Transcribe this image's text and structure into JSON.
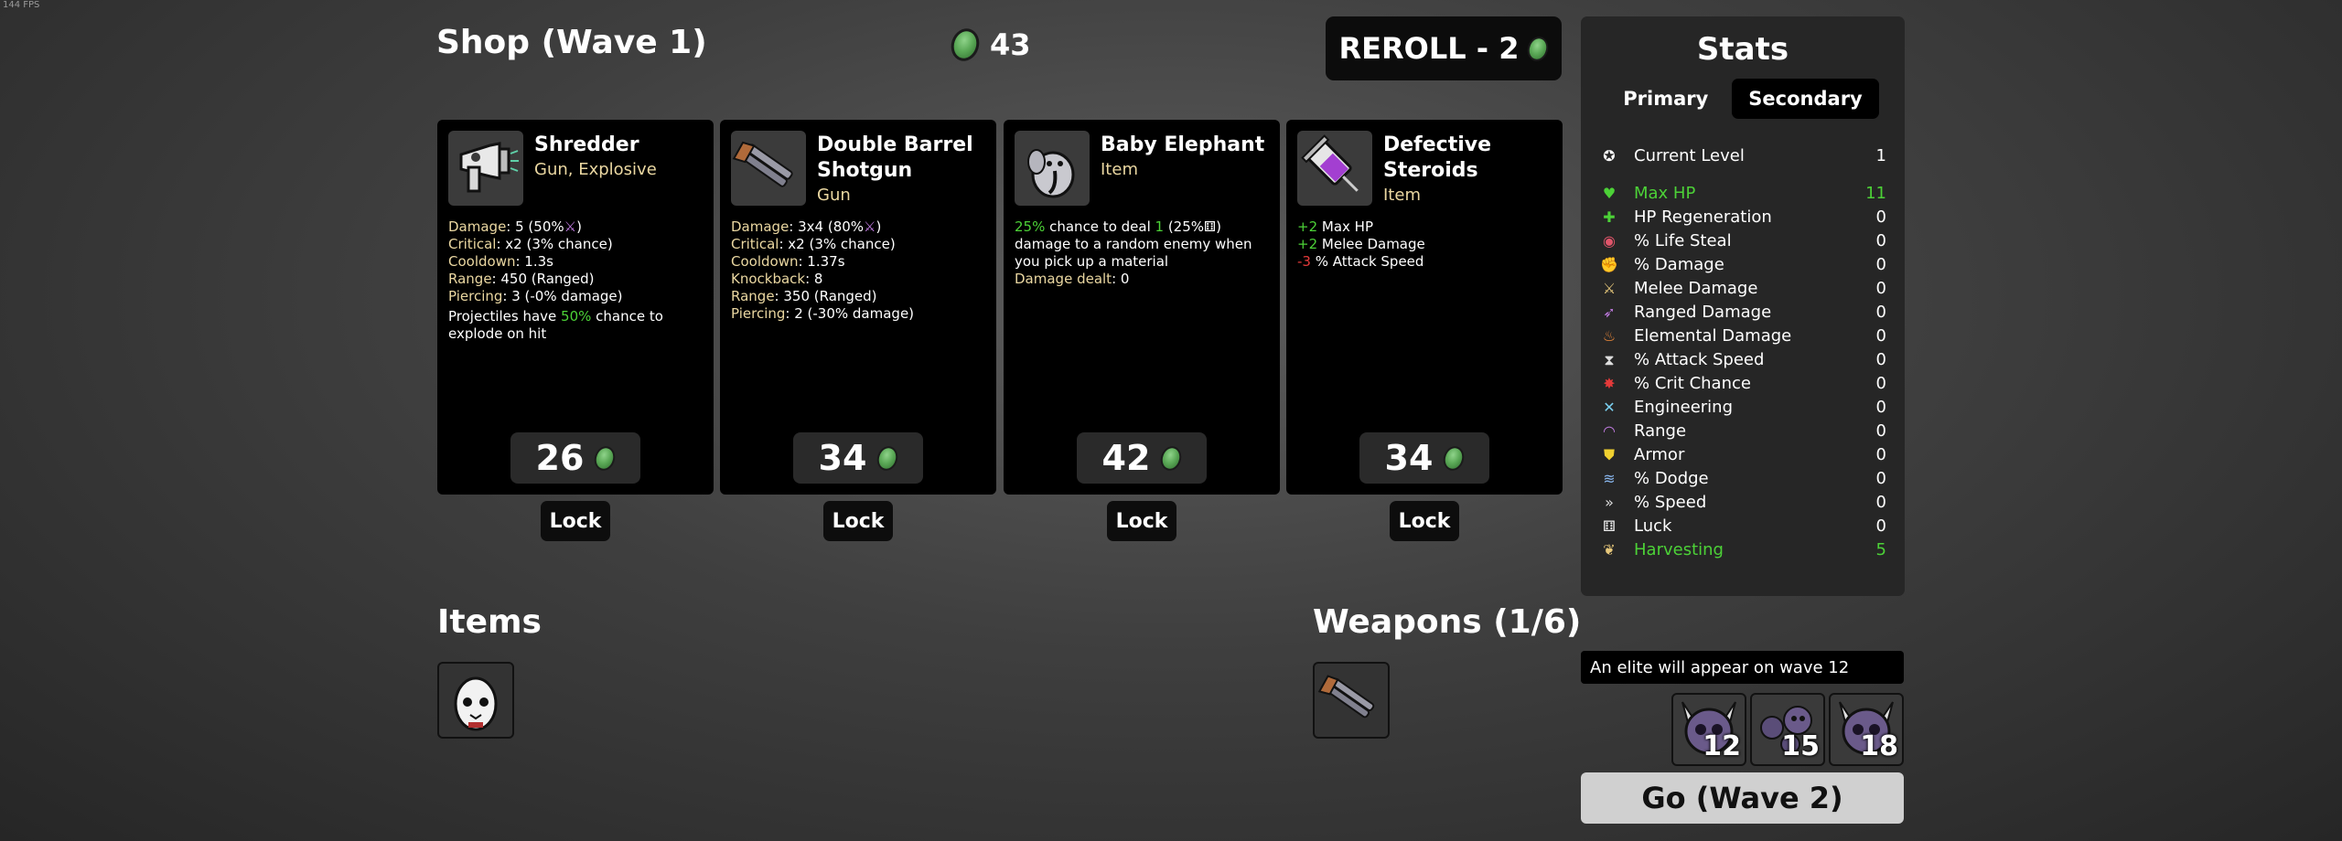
{
  "fps": "144 FPS",
  "header": {
    "title": "Shop (Wave 1)",
    "materials": "43",
    "reroll_label": "REROLL - 2"
  },
  "shop_items": [
    {
      "name": "Shredder",
      "type": "Gun, Explosive",
      "icon": "shredder-icon",
      "stats": [
        {
          "label": "Damage",
          "value": ": 5 (50%",
          "suffix": ")"
        },
        {
          "label": "Critical",
          "value": ": x2 (3% chance)"
        },
        {
          "label": "Cooldown",
          "value": ": 1.3s"
        },
        {
          "label": "Range",
          "value": ": 450 (Ranged)"
        },
        {
          "label": "Piercing",
          "value": ": 3 (-0% damage)"
        }
      ],
      "desc_pre": "Projectiles have ",
      "desc_hl": "50%",
      "desc_post": " chance to explode on hit",
      "price": "26",
      "lock_label": "Lock"
    },
    {
      "name": "Double Barrel Shotgun",
      "type": "Gun",
      "icon": "shotgun-icon",
      "stats": [
        {
          "label": "Damage",
          "value": ": 3x4 (80%",
          "suffix": ")"
        },
        {
          "label": "Critical",
          "value": ": x2 (3% chance)"
        },
        {
          "label": "Cooldown",
          "value": ": 1.37s"
        },
        {
          "label": "Knockback",
          "value": ": 8"
        },
        {
          "label": "Range",
          "value": ": 350 (Ranged)"
        },
        {
          "label": "Piercing",
          "value": ": 2 (-30% damage)"
        }
      ],
      "price": "34",
      "lock_label": "Lock"
    },
    {
      "name": "Baby Elephant",
      "type": "Item",
      "icon": "baby-elephant-icon",
      "line1_hl1": "25%",
      "line1_mid": " chance to deal ",
      "line1_hl2": "1",
      "line1_post": " (25%",
      "line1_end": ")",
      "line2": "damage to a random enemy when you pick up a material",
      "dealt_label": "Damage dealt",
      "dealt_value": ": 0",
      "price": "42",
      "lock_label": "Lock"
    },
    {
      "name": "Defective Steroids",
      "type": "Item",
      "icon": "syringe-icon",
      "effects": [
        {
          "sign": "+2",
          "text": " Max HP",
          "color": "#4cd137"
        },
        {
          "sign": "+2",
          "text": " Melee Damage",
          "color": "#4cd137"
        },
        {
          "sign": "-3",
          "text": " % Attack Speed",
          "color": "#e53a3a"
        }
      ],
      "price": "34",
      "lock_label": "Lock"
    }
  ],
  "items_section": {
    "title": "Items",
    "slots": [
      "egg-character-icon"
    ]
  },
  "weapons_section": {
    "title": "Weapons (1/6)",
    "slots": [
      "shotgun-icon"
    ]
  },
  "stats": {
    "title": "Stats",
    "tabs": [
      "Primary",
      "Secondary"
    ],
    "active_tab": "Secondary",
    "current_level": {
      "label": "Current Level",
      "value": "1",
      "icon": "level-icon"
    },
    "rows": [
      {
        "label": "Max HP",
        "value": "11",
        "icon": "heart-icon",
        "highlight": true
      },
      {
        "label": "HP Regeneration",
        "value": "0",
        "icon": "regen-icon"
      },
      {
        "label": "% Life Steal",
        "value": "0",
        "icon": "lifesteal-icon"
      },
      {
        "label": "% Damage",
        "value": "0",
        "icon": "muscle-icon"
      },
      {
        "label": "Melee Damage",
        "value": "0",
        "icon": "sword-icon"
      },
      {
        "label": "Ranged Damage",
        "value": "0",
        "icon": "bow-icon"
      },
      {
        "label": "Elemental Damage",
        "value": "0",
        "icon": "flame-icon"
      },
      {
        "label": "% Attack Speed",
        "value": "0",
        "icon": "hourglass-icon"
      },
      {
        "label": "% Crit Chance",
        "value": "0",
        "icon": "crit-icon"
      },
      {
        "label": "Engineering",
        "value": "0",
        "icon": "wrench-icon"
      },
      {
        "label": "Range",
        "value": "0",
        "icon": "range-icon"
      },
      {
        "label": "Armor",
        "value": "0",
        "icon": "shield-icon"
      },
      {
        "label": "% Dodge",
        "value": "0",
        "icon": "dodge-icon"
      },
      {
        "label": "% Speed",
        "value": "0",
        "icon": "speed-icon"
      },
      {
        "label": "Luck",
        "value": "0",
        "icon": "dice-icon"
      },
      {
        "label": "Harvesting",
        "value": "5",
        "icon": "harvest-icon",
        "highlight": true
      }
    ]
  },
  "elite_note": "An elite will appear on wave 12",
  "elite_waves": [
    {
      "wave": "12",
      "icon": "horned-skull-icon"
    },
    {
      "wave": "15",
      "icon": "bat-swarm-icon"
    },
    {
      "wave": "18",
      "icon": "horned-skull-icon"
    }
  ],
  "go_label": "Go (Wave 2)",
  "colors": {
    "accent_green": "#4cd137",
    "stat_label": "#ead7a1",
    "negative": "#e53a3a",
    "panel": "#262626"
  }
}
